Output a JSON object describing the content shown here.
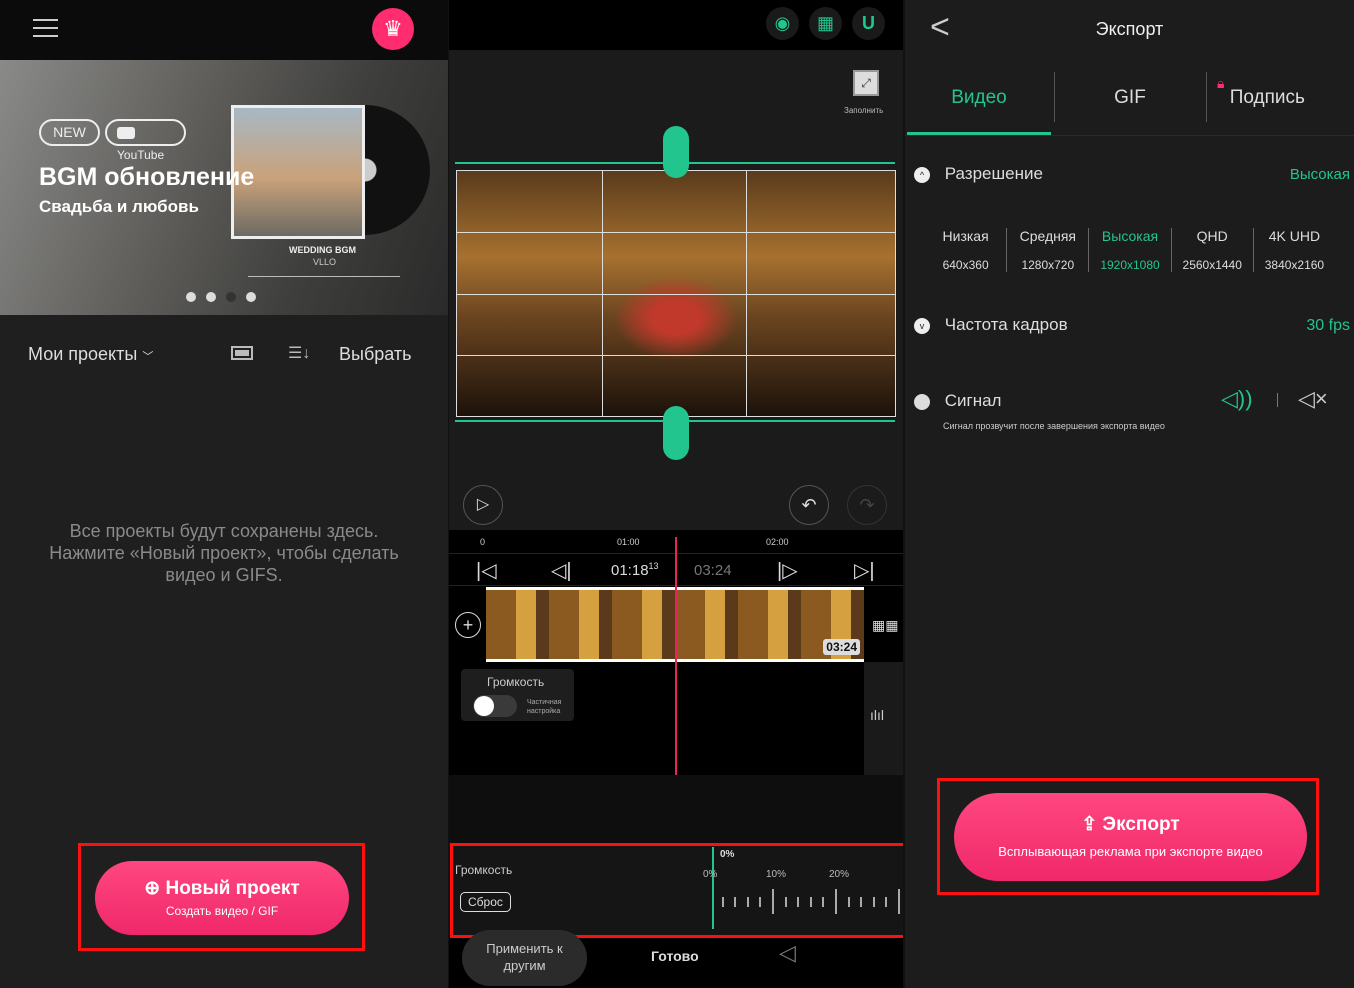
{
  "home": {
    "banner": {
      "badge_new": "NEW",
      "badge_youtube": "YouTube",
      "title": "BGM обновление",
      "subtitle": "Свадьба и любовь",
      "album_title": "WEDDING BGM",
      "album_artist": "VLLO",
      "active_dot": 2
    },
    "projects_dropdown": "Мои проекты",
    "select_label": "Выбрать",
    "empty_text_1": "Все проекты будут сохранены здесь.",
    "empty_text_2": "Нажмите «Новый проект», чтобы сделать",
    "empty_text_3": "видео и GIFS.",
    "new_project_label": "Новый проект",
    "new_project_sub": "Создать видео / GIF"
  },
  "editor": {
    "fill_label": "Заполнить",
    "ruler": [
      "0",
      "01:00",
      "02:00"
    ],
    "current_time": "01:18",
    "current_frame": "13",
    "total_time": "03:24",
    "clip_duration": "03:24",
    "volume_popup_title": "Громкость",
    "partial_label_1": "Частичная",
    "partial_label_2": "настройка",
    "volume_label": "Громкость",
    "reset_label": "Сброс",
    "volume_value": "0%",
    "scale_labels": [
      "0%",
      "10%",
      "20%"
    ],
    "apply_label_1": "Применить к",
    "apply_label_2": "другим",
    "done_label": "Готово"
  },
  "export": {
    "title": "Экспорт",
    "tabs": [
      "Видео",
      "GIF",
      "Подпись"
    ],
    "active_tab": 0,
    "resolution_label": "Разрешение",
    "resolution_value": "Высокая",
    "resolutions": [
      {
        "name": "Низкая",
        "size": "640x360"
      },
      {
        "name": "Средняя",
        "size": "1280x720"
      },
      {
        "name": "Высокая",
        "size": "1920x1080"
      },
      {
        "name": "QHD",
        "size": "2560x1440"
      },
      {
        "name": "4K UHD",
        "size": "3840x2160"
      }
    ],
    "selected_resolution": 2,
    "fps_label": "Частота кадров",
    "fps_value": "30 fps",
    "signal_label": "Сигнал",
    "signal_desc": "Сигнал прозвучит после завершения экспорта видео",
    "export_button": "Экспорт",
    "export_sub": "Всплывающая реклама при экспорте видео"
  },
  "colors": {
    "accent": "#22c58e",
    "brand": "#ff2d6f",
    "highlight": "#ff1010"
  }
}
